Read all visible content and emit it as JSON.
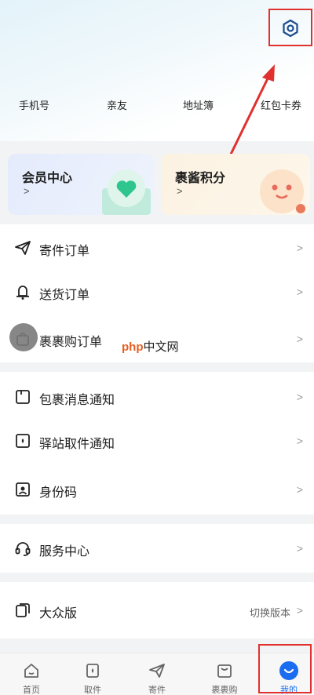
{
  "header": {
    "settings_icon": "settings-icon"
  },
  "quick_links": [
    {
      "label": "手机号"
    },
    {
      "label": "亲友"
    },
    {
      "label": "地址簿"
    },
    {
      "label": "红包卡券"
    }
  ],
  "cards": {
    "member": {
      "title": "会员中心",
      "arrow": ">"
    },
    "points": {
      "title": "裹酱积分",
      "arrow": ">"
    }
  },
  "menu_groups": {
    "orders": [
      {
        "label": "寄件订单",
        "icon": "paper-plane-icon"
      },
      {
        "label": "送货订单",
        "icon": "bell-icon"
      },
      {
        "label": "裹裹购订单",
        "icon": "bag-icon"
      }
    ],
    "notices": [
      {
        "label": "包裹消息通知",
        "icon": "package-icon"
      },
      {
        "label": "驿站取件通知",
        "icon": "station-icon"
      },
      {
        "label": "身份码",
        "icon": "id-card-icon"
      }
    ],
    "service": [
      {
        "label": "服务中心",
        "icon": "headset-icon"
      }
    ],
    "version": [
      {
        "label": "大众版",
        "icon": "copy-icon",
        "extra": "切换版本"
      }
    ]
  },
  "watermark": {
    "brand": "php",
    "text": "中文网"
  },
  "tabbar": [
    {
      "label": "首页",
      "icon": "home-icon"
    },
    {
      "label": "取件",
      "icon": "pickup-icon"
    },
    {
      "label": "寄件",
      "icon": "send-icon"
    },
    {
      "label": "裹裹购",
      "icon": "shop-icon"
    },
    {
      "label": "我的",
      "icon": "mine-icon",
      "active": true
    }
  ],
  "colors": {
    "accent": "#1a6cf0",
    "highlight": "#e0312f"
  }
}
